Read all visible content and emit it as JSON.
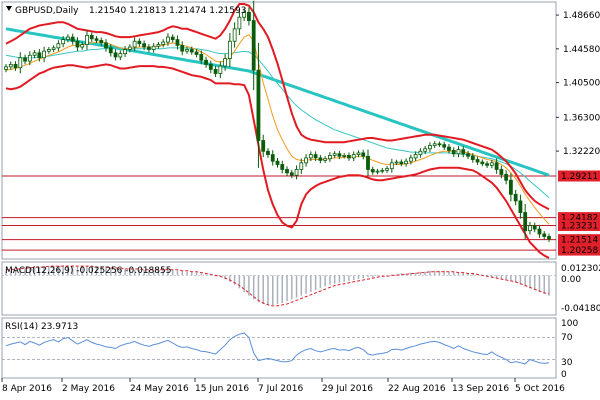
{
  "header": {
    "symbol_label": "GBPUSD,Daily",
    "ohlc_label": "1.21540 1.21813 1.21474 1.21593"
  },
  "macd": {
    "label": "MACD(12,26,9) -0.025256 -0.018855",
    "scale": [
      "0.012302",
      "0.00",
      "-0.041809"
    ]
  },
  "rsi": {
    "label": "RSI(14) 23.9713",
    "scale": [
      "100",
      "70",
      "30",
      "0"
    ]
  },
  "colors": {
    "background": "#ffffff",
    "grid": "#9aa0b0",
    "candle_up": "#0a5c0a",
    "candle_down": "#0a5c0a",
    "bollinger": "#e21b22",
    "ma_orange": "#f29a1f",
    "ma_teal": "#27c4c2",
    "ma_teal_thin": "#39c6c4",
    "horizontal_levels": "#c21a2a",
    "price_tag_red": "#e0202a",
    "macd_hist": "#aab0bb",
    "macd_signal": "#e0202a",
    "rsi_line": "#5b8fd8",
    "rsi_levels": "#9aa0b0"
  },
  "chart_data": {
    "type": "candlestick",
    "symbol": "GBPUSD",
    "timeframe": "Daily",
    "price_axis": [
      "1.48660",
      "1.44580",
      "1.40500",
      "1.36300",
      "1.32220"
    ],
    "price_range": [
      1.193,
      1.5
    ],
    "x_axis_dates": [
      "8 Apr 2016",
      "2 May 2016",
      "24 May 2016",
      "15 Jun 2016",
      "7 Jul 2016",
      "29 Jul 2016",
      "22 Aug 2016",
      "13 Sep 2016",
      "5 Oct 2016"
    ],
    "horizontal_levels": [
      {
        "label": "1.29211",
        "value": 1.29211
      },
      {
        "label": "1.24182",
        "value": 1.24182
      },
      {
        "label": "1.23231",
        "value": 1.23231
      },
      {
        "label": "1.21514",
        "value": 1.21514
      },
      {
        "label": "1.20258",
        "value": 1.20258
      }
    ],
    "last_price": 1.21593,
    "close_series": [
      1.424,
      1.427,
      1.423,
      1.435,
      1.431,
      1.438,
      1.441,
      1.435,
      1.443,
      1.445,
      1.447,
      1.452,
      1.457,
      1.46,
      1.455,
      1.448,
      1.451,
      1.462,
      1.458,
      1.456,
      1.453,
      1.447,
      1.441,
      1.436,
      1.44,
      1.445,
      1.448,
      1.455,
      1.452,
      1.448,
      1.445,
      1.449,
      1.451,
      1.454,
      1.46,
      1.457,
      1.45,
      1.443,
      1.445,
      1.442,
      1.439,
      1.432,
      1.427,
      1.421,
      1.416,
      1.425,
      1.434,
      1.455,
      1.47,
      1.484,
      1.49,
      1.48,
      1.42,
      1.335,
      1.322,
      1.318,
      1.31,
      1.306,
      1.3,
      1.296,
      1.293,
      1.3,
      1.308,
      1.314,
      1.318,
      1.314,
      1.311,
      1.313,
      1.317,
      1.319,
      1.316,
      1.317,
      1.314,
      1.318,
      1.32,
      1.316,
      1.3,
      1.297,
      1.298,
      1.299,
      1.301,
      1.308,
      1.309,
      1.307,
      1.31,
      1.314,
      1.318,
      1.322,
      1.325,
      1.329,
      1.331,
      1.33,
      1.327,
      1.323,
      1.319,
      1.324,
      1.319,
      1.316,
      1.312,
      1.309,
      1.307,
      1.305,
      1.308,
      1.3,
      1.294,
      1.287,
      1.27,
      1.262,
      1.248,
      1.226,
      1.232,
      1.228,
      1.222,
      1.219,
      1.216
    ],
    "bollinger_upper": [
      1.452,
      1.455,
      1.458,
      1.462,
      1.466,
      1.47,
      1.472,
      1.474,
      1.475,
      1.476,
      1.477,
      1.478,
      1.478,
      1.476,
      1.473,
      1.47,
      1.469,
      1.468,
      1.467,
      1.466,
      1.466,
      1.465,
      1.463,
      1.461,
      1.46,
      1.46,
      1.46,
      1.461,
      1.462,
      1.463,
      1.464,
      1.465,
      1.466,
      1.468,
      1.471,
      1.473,
      1.472,
      1.47,
      1.47,
      1.468,
      1.466,
      1.464,
      1.462,
      1.46,
      1.458,
      1.462,
      1.47,
      1.48,
      1.492,
      1.5,
      1.5,
      1.498,
      1.49,
      1.478,
      1.47,
      1.46,
      1.445,
      1.428,
      1.408,
      1.388,
      1.368,
      1.352,
      1.342,
      1.338,
      1.336,
      1.335,
      1.334,
      1.333,
      1.333,
      1.333,
      1.333,
      1.333,
      1.334,
      1.335,
      1.336,
      1.337,
      1.338,
      1.338,
      1.337,
      1.336,
      1.335,
      1.335,
      1.336,
      1.337,
      1.338,
      1.339,
      1.34,
      1.341,
      1.342,
      1.342,
      1.342,
      1.341,
      1.34,
      1.339,
      1.338,
      1.337,
      1.336,
      1.334,
      1.332,
      1.33,
      1.328,
      1.326,
      1.324,
      1.32,
      1.315,
      1.31,
      1.303,
      1.295,
      1.285,
      1.275,
      1.268,
      1.262,
      1.258,
      1.255,
      1.252
    ],
    "bollinger_lower": [
      1.398,
      1.397,
      1.398,
      1.4,
      1.404,
      1.408,
      1.412,
      1.416,
      1.418,
      1.421,
      1.423,
      1.424,
      1.425,
      1.426,
      1.426,
      1.425,
      1.424,
      1.423,
      1.424,
      1.425,
      1.426,
      1.427,
      1.426,
      1.424,
      1.422,
      1.422,
      1.423,
      1.424,
      1.425,
      1.425,
      1.425,
      1.425,
      1.424,
      1.424,
      1.423,
      1.422,
      1.42,
      1.418,
      1.416,
      1.414,
      1.413,
      1.412,
      1.41,
      1.408,
      1.404,
      1.404,
      1.404,
      1.404,
      1.403,
      1.403,
      1.402,
      1.39,
      1.36,
      1.33,
      1.3,
      1.275,
      1.258,
      1.245,
      1.236,
      1.232,
      1.23,
      1.238,
      1.258,
      1.27,
      1.276,
      1.28,
      1.283,
      1.285,
      1.287,
      1.289,
      1.291,
      1.292,
      1.293,
      1.293,
      1.293,
      1.292,
      1.29,
      1.288,
      1.287,
      1.287,
      1.288,
      1.289,
      1.29,
      1.291,
      1.292,
      1.293,
      1.294,
      1.296,
      1.298,
      1.3,
      1.301,
      1.302,
      1.302,
      1.302,
      1.302,
      1.302,
      1.301,
      1.3,
      1.299,
      1.296,
      1.292,
      1.288,
      1.284,
      1.278,
      1.27,
      1.262,
      1.252,
      1.242,
      1.232,
      1.222,
      1.212,
      1.206,
      1.2,
      1.196,
      1.193
    ],
    "ma_orange": [
      1.42,
      1.421,
      1.422,
      1.424,
      1.426,
      1.428,
      1.431,
      1.433,
      1.436,
      1.438,
      1.44,
      1.442,
      1.445,
      1.448,
      1.45,
      1.45,
      1.45,
      1.452,
      1.453,
      1.454,
      1.454,
      1.453,
      1.451,
      1.449,
      1.447,
      1.446,
      1.446,
      1.447,
      1.448,
      1.448,
      1.448,
      1.448,
      1.449,
      1.45,
      1.452,
      1.453,
      1.452,
      1.45,
      1.449,
      1.447,
      1.445,
      1.442,
      1.439,
      1.435,
      1.431,
      1.43,
      1.431,
      1.436,
      1.443,
      1.452,
      1.46,
      1.463,
      1.455,
      1.43,
      1.405,
      1.385,
      1.365,
      1.348,
      1.336,
      1.325,
      1.316,
      1.312,
      1.311,
      1.311,
      1.312,
      1.312,
      1.312,
      1.312,
      1.313,
      1.314,
      1.314,
      1.315,
      1.315,
      1.315,
      1.316,
      1.316,
      1.314,
      1.311,
      1.309,
      1.307,
      1.306,
      1.306,
      1.306,
      1.306,
      1.307,
      1.308,
      1.31,
      1.312,
      1.314,
      1.317,
      1.319,
      1.321,
      1.322,
      1.322,
      1.322,
      1.322,
      1.321,
      1.32,
      1.318,
      1.316,
      1.314,
      1.312,
      1.311,
      1.309,
      1.306,
      1.302,
      1.296,
      1.289,
      1.28,
      1.27,
      1.262,
      1.254,
      1.247,
      1.24,
      1.234
    ],
    "ma_teal_thin": [
      1.438,
      1.437,
      1.436,
      1.435,
      1.435,
      1.435,
      1.435,
      1.436,
      1.436,
      1.437,
      1.438,
      1.439,
      1.44,
      1.441,
      1.442,
      1.443,
      1.443,
      1.444,
      1.445,
      1.445,
      1.446,
      1.446,
      1.446,
      1.446,
      1.446,
      1.446,
      1.446,
      1.446,
      1.446,
      1.446,
      1.446,
      1.446,
      1.446,
      1.446,
      1.447,
      1.447,
      1.447,
      1.447,
      1.447,
      1.446,
      1.446,
      1.445,
      1.444,
      1.443,
      1.441,
      1.44,
      1.44,
      1.44,
      1.441,
      1.442,
      1.443,
      1.442,
      1.439,
      1.433,
      1.426,
      1.419,
      1.411,
      1.404,
      1.397,
      1.39,
      1.383,
      1.377,
      1.372,
      1.368,
      1.364,
      1.36,
      1.357,
      1.354,
      1.351,
      1.348,
      1.346,
      1.344,
      1.342,
      1.34,
      1.338,
      1.336,
      1.334,
      1.332,
      1.33,
      1.328,
      1.326,
      1.325,
      1.324,
      1.323,
      1.322,
      1.321,
      1.321,
      1.32,
      1.32,
      1.32,
      1.32,
      1.32,
      1.32,
      1.32,
      1.319,
      1.319,
      1.318,
      1.318,
      1.317,
      1.316,
      1.315,
      1.314,
      1.313,
      1.311,
      1.309,
      1.307,
      1.304,
      1.3,
      1.296,
      1.291,
      1.286,
      1.281,
      1.276,
      1.271,
      1.266
    ],
    "ma_teal_thick": [
      1.47,
      1.469,
      1.468,
      1.467,
      1.466,
      1.465,
      1.464,
      1.463,
      1.462,
      1.461,
      1.46,
      1.459,
      1.458,
      1.457,
      1.456,
      1.455,
      1.454,
      1.453,
      1.452,
      1.451,
      1.45,
      1.449,
      1.448,
      1.447,
      1.446,
      1.445,
      1.444,
      1.443,
      1.442,
      1.441,
      1.44,
      1.439,
      1.438,
      1.437,
      1.436,
      1.435,
      1.434,
      1.433,
      1.432,
      1.431,
      1.43,
      1.429,
      1.428,
      1.427,
      1.426,
      1.425,
      1.424,
      1.423,
      1.422,
      1.421,
      1.42,
      1.419,
      1.417,
      1.415,
      1.413,
      1.411,
      1.409,
      1.407,
      1.405,
      1.403,
      1.401,
      1.399,
      1.397,
      1.395,
      1.393,
      1.391,
      1.389,
      1.387,
      1.385,
      1.383,
      1.381,
      1.379,
      1.377,
      1.375,
      1.373,
      1.371,
      1.369,
      1.367,
      1.365,
      1.363,
      1.361,
      1.359,
      1.357,
      1.355,
      1.353,
      1.351,
      1.349,
      1.347,
      1.345,
      1.343,
      1.341,
      1.339,
      1.337,
      1.335,
      1.333,
      1.331,
      1.329,
      1.327,
      1.325,
      1.323,
      1.321,
      1.319,
      1.317,
      1.315,
      1.313,
      1.311,
      1.309,
      1.307,
      1.305,
      1.303,
      1.301,
      1.299,
      1.297,
      1.295,
      1.293
    ],
    "macd_hist": [
      0.004,
      0.005,
      0.006,
      0.007,
      0.008,
      0.008,
      0.009,
      0.009,
      0.009,
      0.01,
      0.01,
      0.01,
      0.011,
      0.011,
      0.011,
      0.01,
      0.01,
      0.01,
      0.01,
      0.009,
      0.009,
      0.008,
      0.008,
      0.007,
      0.007,
      0.007,
      0.007,
      0.006,
      0.006,
      0.006,
      0.006,
      0.006,
      0.006,
      0.006,
      0.006,
      0.006,
      0.005,
      0.005,
      0.004,
      0.004,
      0.003,
      0.002,
      0.001,
      0.0,
      -0.001,
      -0.002,
      -0.004,
      -0.007,
      -0.01,
      -0.014,
      -0.018,
      -0.022,
      -0.026,
      -0.029,
      -0.031,
      -0.032,
      -0.032,
      -0.031,
      -0.03,
      -0.028,
      -0.026,
      -0.024,
      -0.022,
      -0.02,
      -0.018,
      -0.016,
      -0.014,
      -0.012,
      -0.01,
      -0.009,
      -0.008,
      -0.007,
      -0.006,
      -0.005,
      -0.004,
      -0.003,
      -0.002,
      -0.002,
      -0.001,
      0.0,
      0.0,
      0.001,
      0.001,
      0.002,
      0.002,
      0.003,
      0.003,
      0.004,
      0.004,
      0.005,
      0.005,
      0.005,
      0.005,
      0.004,
      0.004,
      0.003,
      0.003,
      0.002,
      0.002,
      0.001,
      0.0,
      -0.001,
      -0.002,
      -0.003,
      -0.004,
      -0.005,
      -0.006,
      -0.008,
      -0.01,
      -0.012,
      -0.014,
      -0.016,
      -0.018,
      -0.02,
      -0.022
    ],
    "macd_signal": [
      0.006,
      0.006,
      0.007,
      0.007,
      0.008,
      0.008,
      0.009,
      0.009,
      0.009,
      0.01,
      0.01,
      0.01,
      0.01,
      0.01,
      0.01,
      0.01,
      0.01,
      0.01,
      0.01,
      0.009,
      0.009,
      0.009,
      0.008,
      0.008,
      0.008,
      0.007,
      0.007,
      0.007,
      0.007,
      0.006,
      0.006,
      0.006,
      0.006,
      0.006,
      0.006,
      0.006,
      0.006,
      0.005,
      0.005,
      0.004,
      0.004,
      0.003,
      0.002,
      0.001,
      0.0,
      -0.001,
      -0.003,
      -0.005,
      -0.008,
      -0.011,
      -0.015,
      -0.019,
      -0.023,
      -0.027,
      -0.03,
      -0.032,
      -0.033,
      -0.033,
      -0.032,
      -0.031,
      -0.029,
      -0.027,
      -0.025,
      -0.023,
      -0.021,
      -0.019,
      -0.017,
      -0.015,
      -0.013,
      -0.011,
      -0.01,
      -0.009,
      -0.008,
      -0.007,
      -0.006,
      -0.005,
      -0.004,
      -0.003,
      -0.002,
      -0.001,
      -0.001,
      0.0,
      0.0,
      0.001,
      0.001,
      0.002,
      0.002,
      0.003,
      0.003,
      0.004,
      0.004,
      0.004,
      0.004,
      0.004,
      0.004,
      0.003,
      0.003,
      0.002,
      0.002,
      0.001,
      0.0,
      -0.001,
      -0.002,
      -0.003,
      -0.004,
      -0.005,
      -0.006,
      -0.007,
      -0.009,
      -0.011,
      -0.013,
      -0.015,
      -0.017,
      -0.019,
      -0.02
    ],
    "rsi": [
      55,
      58,
      60,
      62,
      57,
      63,
      60,
      56,
      61,
      64,
      66,
      62,
      68,
      70,
      64,
      58,
      62,
      66,
      61,
      58,
      56,
      53,
      52,
      50,
      55,
      58,
      60,
      63,
      59,
      56,
      54,
      57,
      59,
      62,
      65,
      60,
      55,
      52,
      53,
      50,
      48,
      45,
      44,
      42,
      40,
      48,
      56,
      66,
      72,
      76,
      78,
      70,
      42,
      28,
      30,
      32,
      30,
      28,
      26,
      26,
      28,
      38,
      44,
      48,
      50,
      46,
      44,
      46,
      49,
      50,
      47,
      48,
      46,
      50,
      52,
      48,
      40,
      38,
      40,
      41,
      43,
      48,
      49,
      47,
      50,
      53,
      55,
      58,
      60,
      62,
      63,
      61,
      57,
      54,
      50,
      55,
      50,
      47,
      44,
      42,
      40,
      39,
      44,
      38,
      34,
      30,
      24,
      26,
      24,
      22,
      30,
      27,
      24,
      23,
      24
    ],
    "rsi_levels": [
      70,
      30
    ]
  }
}
